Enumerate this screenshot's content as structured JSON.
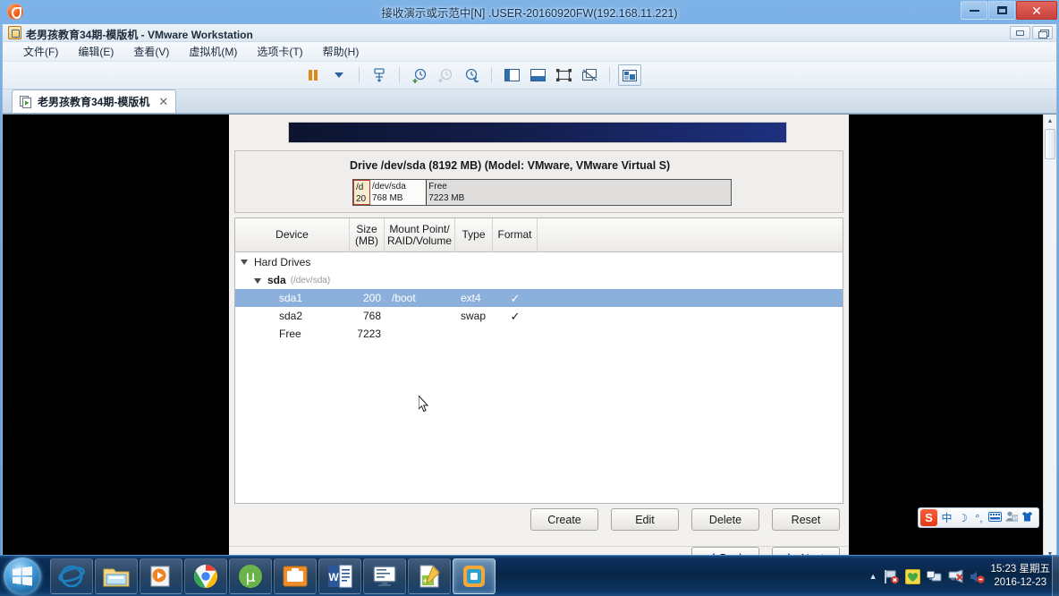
{
  "outer_window": {
    "title": "接收演示或示范中[N] .USER-20160920FW(192.168.11.221)",
    "app_icon": "remote-session-icon",
    "buttons": {
      "minimize": "minimize-icon",
      "maximize": "maximize-icon",
      "close": "✕"
    }
  },
  "vmware": {
    "title": "老男孩教育34期-模版机 - VMware Workstation",
    "title_icon": "vmware-app-icon",
    "window_buttons": {
      "minimize": "minimize-icon",
      "restore": "restore-icon"
    },
    "menus": [
      {
        "label": "文件(F)",
        "name": "menu-file"
      },
      {
        "label": "编辑(E)",
        "name": "menu-edit"
      },
      {
        "label": "查看(V)",
        "name": "menu-view"
      },
      {
        "label": "虚拟机(M)",
        "name": "menu-vm"
      },
      {
        "label": "选项卡(T)",
        "name": "menu-tabs"
      },
      {
        "label": "帮助(H)",
        "name": "menu-help"
      }
    ],
    "toolbar": [
      {
        "name": "pause-icon",
        "label": "暂停"
      },
      {
        "name": "chevron-down-icon",
        "label": "更多"
      },
      {
        "name": "manage-snapshots-icon",
        "label": "快照管理器"
      },
      {
        "name": "take-snapshot-icon",
        "label": "拍摄快照"
      },
      {
        "name": "revert-snapshot-icon",
        "label": "恢复快照"
      },
      {
        "name": "snapshot-manager-icon",
        "label": "管理快照"
      },
      {
        "name": "show-library-icon",
        "label": "显示资源库"
      },
      {
        "name": "console-view-icon",
        "label": "控制台视图"
      },
      {
        "name": "fullscreen-icon",
        "label": "全屏"
      },
      {
        "name": "unity-mode-icon",
        "label": "Unity 模式"
      },
      {
        "name": "show-thumbnail-bar-icon",
        "label": "缩略图栏"
      }
    ],
    "tabs": [
      {
        "label": "老男孩教育34期-模版机",
        "close": "✕",
        "icon": "vm-tab-icon"
      }
    ]
  },
  "installer": {
    "drive_title": "Drive /dev/sda (8192 MB) (Model: VMware, VMware Virtual S)",
    "drive_bar": [
      {
        "name": "/d",
        "size": "20",
        "selected": true,
        "width_pct": 3.2
      },
      {
        "name": "/dev/sda",
        "size": "768 MB",
        "selected": false,
        "width_pct": 13.5
      },
      {
        "name": "Free",
        "size": "7223 MB",
        "selected": false,
        "width_pct": 83.3
      }
    ],
    "table": {
      "headers": [
        {
          "label": "Device",
          "name": "column-device"
        },
        {
          "label": "Size\n(MB)",
          "line1": "Size",
          "line2": "(MB)",
          "name": "column-size"
        },
        {
          "label": "Mount Point/\nRAID/Volume",
          "line1": "Mount Point/",
          "line2": "RAID/Volume",
          "name": "column-mount"
        },
        {
          "label": "Type",
          "name": "column-type"
        },
        {
          "label": "Format",
          "name": "column-format"
        }
      ],
      "rows": [
        {
          "device": "Hard Drives",
          "indent": 0,
          "expander": "▽",
          "size": "",
          "mount": "",
          "type": "",
          "format": "",
          "selected": false,
          "path": ""
        },
        {
          "device": "sda",
          "indent": 1,
          "expander": "▽",
          "size": "",
          "mount": "",
          "type": "",
          "format": "",
          "selected": false,
          "path": "(/dev/sda)"
        },
        {
          "device": "sda1",
          "indent": 2,
          "expander": "",
          "size": "200",
          "mount": "/boot",
          "type": "ext4",
          "format": "✓",
          "selected": true,
          "path": ""
        },
        {
          "device": "sda2",
          "indent": 2,
          "expander": "",
          "size": "768",
          "mount": "",
          "type": "swap",
          "format": "✓",
          "selected": false,
          "path": ""
        },
        {
          "device": "Free",
          "indent": 2,
          "expander": "",
          "size": "7223",
          "mount": "",
          "type": "",
          "format": "",
          "selected": false,
          "path": ""
        }
      ]
    },
    "action_buttons": [
      {
        "label": "Create",
        "name": "create-button"
      },
      {
        "label": "Edit",
        "name": "edit-button"
      },
      {
        "label": "Delete",
        "name": "delete-button"
      },
      {
        "label": "Reset",
        "name": "reset-button"
      }
    ],
    "nav_buttons": [
      {
        "label": "Back",
        "name": "back-button",
        "arrow": "left"
      },
      {
        "label": "Next",
        "name": "next-button",
        "arrow": "right"
      }
    ],
    "colors": {
      "selection": "#8cb0dc",
      "banner_start": "#0d1430",
      "banner_end": "#1e3080",
      "segment_selected": "#f5ecd2",
      "segment_selected_border": "#c0392b"
    }
  },
  "ime": {
    "logo": "S",
    "items": [
      {
        "glyph": "中",
        "name": "ime-chinese-mode-icon"
      },
      {
        "glyph": "☽",
        "name": "ime-moon-icon"
      },
      {
        "glyph": "°,",
        "name": "ime-punctuation-icon"
      },
      {
        "glyph": "⌨",
        "name": "ime-soft-keyboard-icon"
      },
      {
        "glyph": "👤",
        "name": "ime-user-icon"
      },
      {
        "glyph": "👕",
        "name": "ime-skin-icon"
      }
    ]
  },
  "taskbar": {
    "start": "start-orb",
    "items": [
      {
        "name": "taskbar-internet-explorer",
        "label": "Internet Explorer"
      },
      {
        "name": "taskbar-windows-explorer",
        "label": "Windows 资源管理器"
      },
      {
        "name": "taskbar-media-player",
        "label": "媒体播放器"
      },
      {
        "name": "taskbar-chrome",
        "label": "Google Chrome"
      },
      {
        "name": "taskbar-utorrent",
        "label": "µTorrent"
      },
      {
        "name": "taskbar-toolbox",
        "label": "工具箱"
      },
      {
        "name": "taskbar-word",
        "label": "Microsoft Word"
      },
      {
        "name": "taskbar-terminal",
        "label": "终端"
      },
      {
        "name": "taskbar-notepadpp",
        "label": "Notepad++"
      },
      {
        "name": "taskbar-vmware",
        "label": "VMware Workstation",
        "active": true
      }
    ],
    "tray": {
      "chevron": "▲",
      "icons": [
        {
          "name": "action-center-flag-icon"
        },
        {
          "name": "security-heart-icon"
        },
        {
          "name": "network-monitor-icon"
        },
        {
          "name": "network-disconnected-icon"
        },
        {
          "name": "volume-muted-icon"
        }
      ],
      "clock_time": "15:23 星期五",
      "clock_date": "2016-12-23"
    }
  }
}
